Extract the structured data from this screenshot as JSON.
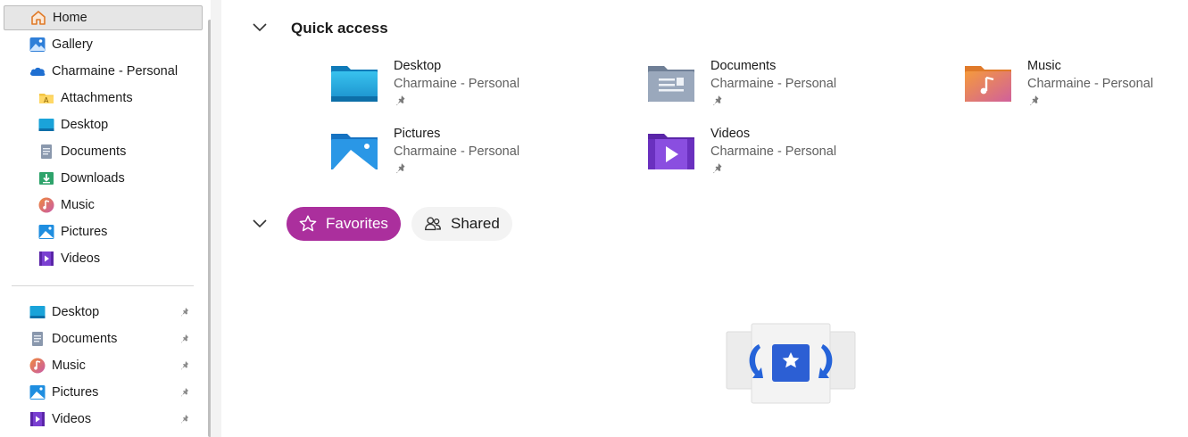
{
  "sidebar": {
    "items": [
      {
        "label": "Home",
        "icon": "home-icon"
      },
      {
        "label": "Gallery",
        "icon": "gallery-icon"
      },
      {
        "label": "Charmaine - Personal",
        "icon": "onedrive-cloud-icon"
      },
      {
        "label": "Attachments",
        "icon": "attachments-folder-icon"
      },
      {
        "label": "Desktop",
        "icon": "desktop-folder-icon"
      },
      {
        "label": "Documents",
        "icon": "documents-folder-icon"
      },
      {
        "label": "Downloads",
        "icon": "downloads-folder-icon"
      },
      {
        "label": "Music",
        "icon": "music-folder-icon"
      },
      {
        "label": "Pictures",
        "icon": "pictures-folder-icon"
      },
      {
        "label": "Videos",
        "icon": "videos-folder-icon"
      }
    ],
    "pinned": [
      {
        "label": "Desktop",
        "icon": "desktop-folder-icon"
      },
      {
        "label": "Documents",
        "icon": "documents-folder-icon"
      },
      {
        "label": "Music",
        "icon": "music-folder-icon"
      },
      {
        "label": "Pictures",
        "icon": "pictures-folder-icon"
      },
      {
        "label": "Videos",
        "icon": "videos-folder-icon"
      }
    ],
    "selected": "Home"
  },
  "quick_access": {
    "title": "Quick access",
    "tiles": [
      {
        "name": "Desktop",
        "location": "Charmaine - Personal",
        "icon": "desktop-folder-icon"
      },
      {
        "name": "Documents",
        "location": "Charmaine - Personal",
        "icon": "documents-folder-icon"
      },
      {
        "name": "Music",
        "location": "Charmaine - Personal",
        "icon": "music-folder-icon"
      },
      {
        "name": "Pictures",
        "location": "Charmaine - Personal",
        "icon": "pictures-folder-icon"
      },
      {
        "name": "Videos",
        "location": "Charmaine - Personal",
        "icon": "videos-folder-icon"
      }
    ]
  },
  "filters": {
    "favorites_label": "Favorites",
    "shared_label": "Shared"
  },
  "colors": {
    "favorites_accent": "#ab2f9d",
    "selection_bg": "#e6e6e6"
  }
}
